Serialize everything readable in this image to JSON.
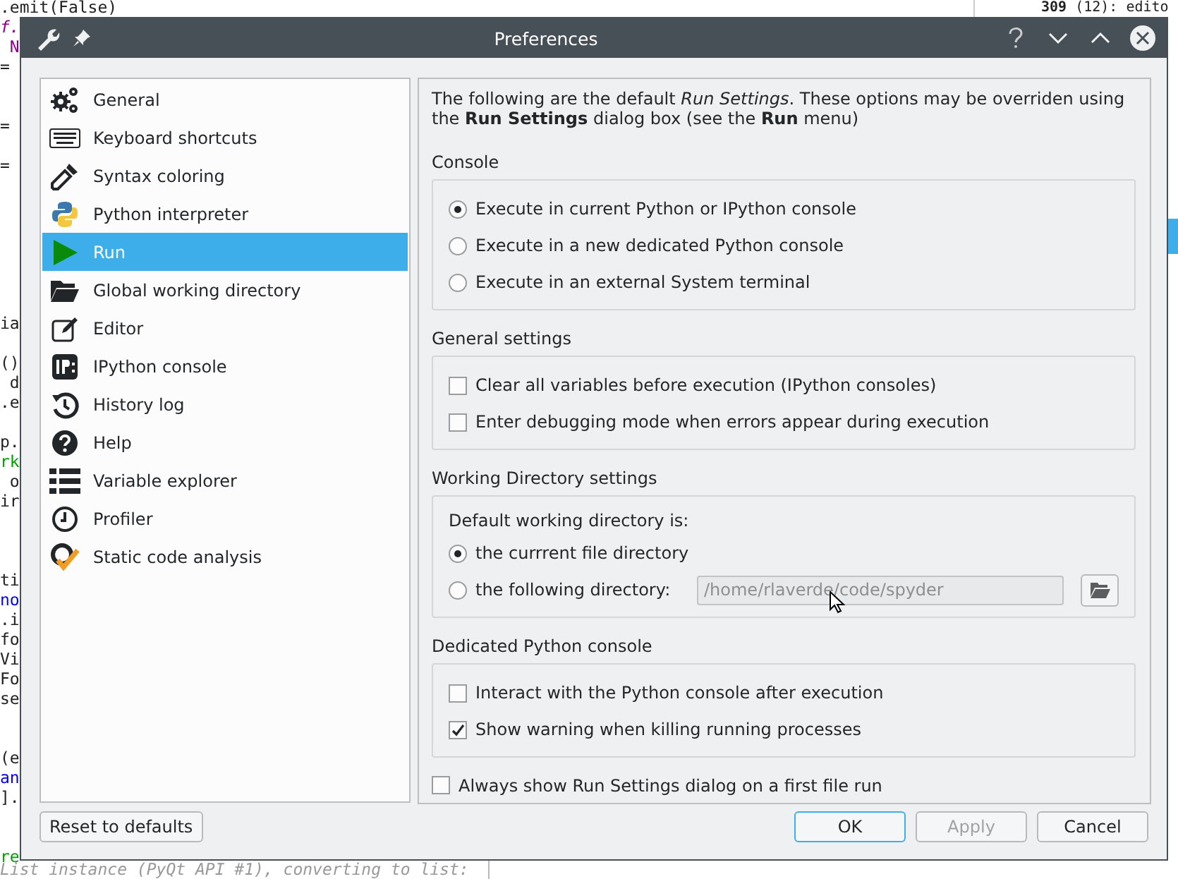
{
  "editor": {
    "lines": [
      {
        "kind": "code",
        "text": ".emit(False)"
      },
      {
        "kind": "code",
        "text": "f.",
        "color": "#8b008b"
      },
      {
        "kind": "code",
        "text": " N",
        "color": "#8b008b"
      },
      {
        "kind": "code",
        "text": "="
      },
      {
        "kind": "blank"
      },
      {
        "kind": "blank"
      },
      {
        "kind": "code",
        "text": "="
      },
      {
        "kind": "blank"
      },
      {
        "kind": "code",
        "text": "="
      },
      {
        "kind": "blank"
      },
      {
        "kind": "blank"
      },
      {
        "kind": "blank"
      },
      {
        "kind": "blank"
      },
      {
        "kind": "blank"
      },
      {
        "kind": "blank"
      },
      {
        "kind": "blank"
      },
      {
        "kind": "code",
        "text": "ia"
      },
      {
        "kind": "blank"
      },
      {
        "kind": "code",
        "text": "()"
      },
      {
        "kind": "code",
        "text": " d"
      },
      {
        "kind": "code",
        "text": ".e"
      },
      {
        "kind": "blank"
      },
      {
        "kind": "code",
        "text": "p."
      },
      {
        "kind": "code",
        "text": "rk",
        "color": "#00a000"
      },
      {
        "kind": "code",
        "text": " o"
      },
      {
        "kind": "code",
        "text": "ir"
      },
      {
        "kind": "blank"
      },
      {
        "kind": "blank"
      },
      {
        "kind": "blank"
      },
      {
        "kind": "code",
        "text": "ti"
      },
      {
        "kind": "code",
        "text": "no",
        "color": "#0000ff"
      },
      {
        "kind": "code",
        "text": ".i"
      },
      {
        "kind": "code",
        "text": "fo"
      },
      {
        "kind": "code",
        "text": "Vi"
      },
      {
        "kind": "code",
        "text": "Fo"
      },
      {
        "kind": "code",
        "text": "se"
      },
      {
        "kind": "blank"
      },
      {
        "kind": "blank"
      },
      {
        "kind": "code",
        "text": "(e"
      },
      {
        "kind": "code",
        "text": "an",
        "color": "#0000ff"
      },
      {
        "kind": "code",
        "text": "]."
      },
      {
        "kind": "blank"
      },
      {
        "kind": "blank"
      },
      {
        "kind": "code",
        "text": "re",
        "color": "#00a000"
      }
    ],
    "status_text": "List instance (PyQt API #1), converting to list:",
    "match_info": "**309** (12): edito"
  },
  "dialog": {
    "title": "Preferences",
    "sidebar": {
      "items": [
        {
          "label": "General",
          "selected": false
        },
        {
          "label": "Keyboard shortcuts",
          "selected": false
        },
        {
          "label": "Syntax coloring",
          "selected": false
        },
        {
          "label": "Python interpreter",
          "selected": false
        },
        {
          "label": "Run",
          "selected": true
        },
        {
          "label": "Global working directory",
          "selected": false
        },
        {
          "label": "Editor",
          "selected": false
        },
        {
          "label": "IPython console",
          "selected": false
        },
        {
          "label": "History log",
          "selected": false
        },
        {
          "label": "Help",
          "selected": false
        },
        {
          "label": "Variable explorer",
          "selected": false
        },
        {
          "label": "Profiler",
          "selected": false
        },
        {
          "label": "Static code analysis",
          "selected": false
        }
      ]
    },
    "intro": "The following are the default *Run Settings*. These options may be overriden using the **Run Settings** dialog box (see the **Run** menu)",
    "sections": [
      {
        "title": "Console",
        "items": [
          {
            "kind": "radio",
            "label": "Execute in current Python or IPython console",
            "selected": true
          },
          {
            "kind": "radio",
            "label": "Execute in a new dedicated Python console",
            "selected": false
          },
          {
            "kind": "radio",
            "label": "Execute in an external System terminal",
            "selected": false
          }
        ]
      },
      {
        "title": "General settings",
        "items": [
          {
            "kind": "checkbox",
            "label": "Clear all variables before execution (IPython consoles)",
            "checked": false
          },
          {
            "kind": "checkbox",
            "label": "Enter debugging mode when errors appear during execution",
            "checked": false
          }
        ]
      },
      {
        "title": "Working Directory settings",
        "items": [
          {
            "kind": "text",
            "label": "Default working directory is:"
          },
          {
            "kind": "radio",
            "label": "the currrent file directory",
            "selected": true
          },
          {
            "kind": "radio_path",
            "label": "the following directory:",
            "selected": false,
            "value": "/home/rlaverde/code/spyder",
            "disabled": true
          }
        ]
      },
      {
        "title": "Dedicated Python console",
        "items": [
          {
            "kind": "checkbox",
            "label": "Interact with the Python console after execution",
            "checked": false
          },
          {
            "kind": "checkbox",
            "label": "Show warning when killing running processes",
            "checked": true
          }
        ]
      }
    ],
    "bottom_option": {
      "label": "Always show Run Settings dialog on a first file run",
      "checked": false
    },
    "reset_button": "Reset to defaults",
    "buttons": [
      {
        "label": "OK",
        "focused": true,
        "disabled": false
      },
      {
        "label": "Apply",
        "focused": false,
        "disabled": true
      },
      {
        "label": "Cancel",
        "focused": false,
        "disabled": false
      }
    ]
  }
}
